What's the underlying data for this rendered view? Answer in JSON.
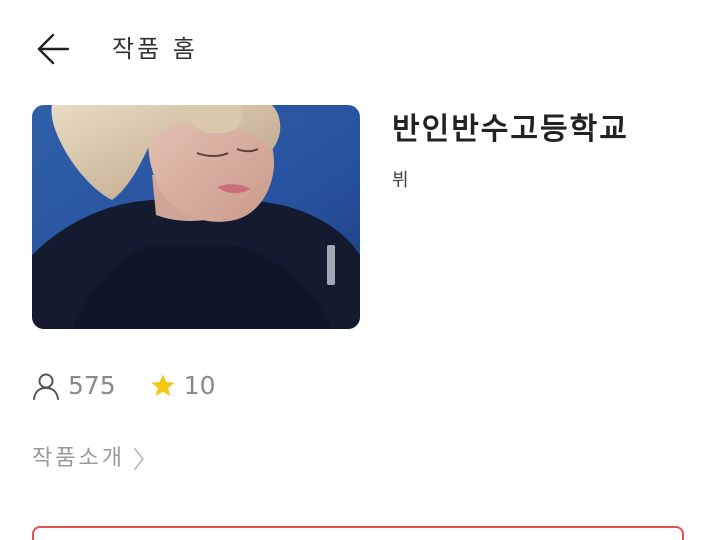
{
  "header": {
    "title": "작품 홈",
    "back_icon": "arrow-left-icon"
  },
  "work": {
    "title": "반인반수고등학교",
    "author": "뷔"
  },
  "stats": {
    "readers": "575",
    "readers_icon": "person-icon",
    "stars": "10",
    "stars_icon": "star-icon",
    "star_color": "#F5C518"
  },
  "intro": {
    "label": "작품소개",
    "icon": "chevron-right-icon"
  },
  "colors": {
    "accent": "#E0524F",
    "text_muted": "#8A8A8A"
  }
}
